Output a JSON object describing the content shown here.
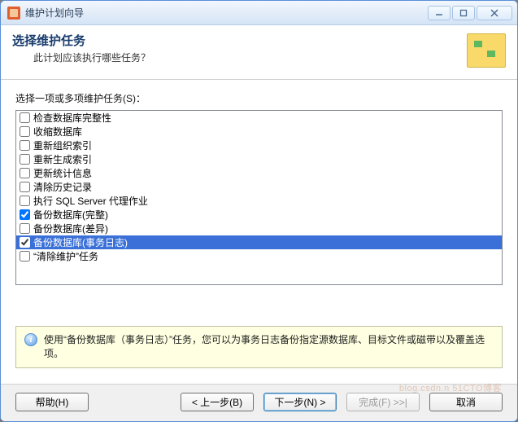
{
  "window": {
    "title": "维护计划向导"
  },
  "header": {
    "title": "选择维护任务",
    "subtitle": "此计划应该执行哪些任务？"
  },
  "content": {
    "list_label": "选择一项或多项维护任务(S)："
  },
  "tasks": [
    {
      "label": "检查数据库完整性",
      "checked": false,
      "selected": false
    },
    {
      "label": "收缩数据库",
      "checked": false,
      "selected": false
    },
    {
      "label": "重新组织索引",
      "checked": false,
      "selected": false
    },
    {
      "label": "重新生成索引",
      "checked": false,
      "selected": false
    },
    {
      "label": "更新统计信息",
      "checked": false,
      "selected": false
    },
    {
      "label": "清除历史记录",
      "checked": false,
      "selected": false
    },
    {
      "label": "执行 SQL Server 代理作业",
      "checked": false,
      "selected": false
    },
    {
      "label": "备份数据库(完整)",
      "checked": true,
      "selected": false
    },
    {
      "label": "备份数据库(差异)",
      "checked": false,
      "selected": false
    },
    {
      "label": "备份数据库(事务日志)",
      "checked": true,
      "selected": true
    },
    {
      "label": "“清除维护”任务",
      "checked": false,
      "selected": false
    }
  ],
  "description": {
    "text": "使用“备份数据库（事务日志）”任务，您可以为事务日志备份指定源数据库、目标文件或磁带以及覆盖选项。"
  },
  "buttons": {
    "help": "帮助(H)",
    "back": "< 上一步(B)",
    "next": "下一步(N) >",
    "finish": "完成(F) >>|",
    "cancel": "取消"
  },
  "watermark": "blog.csdn.n  51CTO博客"
}
